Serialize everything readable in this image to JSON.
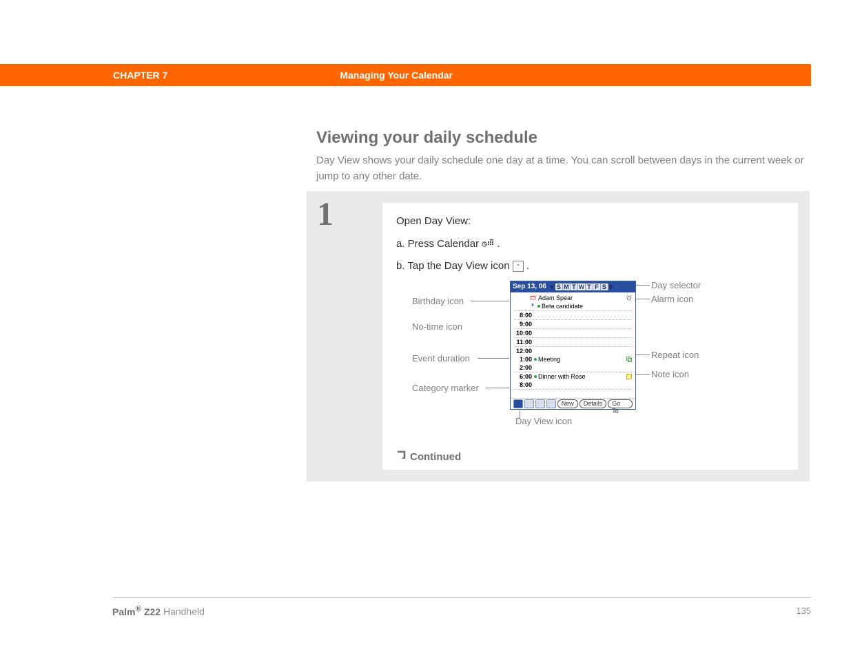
{
  "header": {
    "chapter": "CHAPTER 7",
    "title": "Managing Your Calendar"
  },
  "section": {
    "heading": "Viewing your daily schedule",
    "body": "Day View shows your daily schedule one day at a time. You can scroll between days in the current week or jump to any other date."
  },
  "step": {
    "number": "1",
    "open": "Open Day View:",
    "a_prefix": "a.  Press Calendar ",
    "a_suffix": ".",
    "b_prefix": "b.  Tap the Day View icon ",
    "b_suffix": ".",
    "continued": "Continued"
  },
  "annotations": {
    "birthday": "Birthday icon",
    "notime": "No-time icon",
    "duration": "Event duration",
    "category": "Category marker",
    "dayview": "Day View icon",
    "day_selector": "Day selector",
    "alarm": "Alarm icon",
    "repeat": "Repeat icon",
    "note": "Note icon"
  },
  "pda": {
    "date": "Sep 13, 06",
    "days": [
      "S",
      "M",
      "T",
      "W",
      "T",
      "F",
      "S"
    ],
    "selected_day_index": 3,
    "events": {
      "adam": "Adam Spear",
      "beta": "Beta candidate",
      "meeting": "Meeting",
      "dinner": "Dinner with Rose"
    },
    "times": {
      "t0800": "8:00",
      "t0900": "9:00",
      "t1000": "10:00",
      "t1100": "11:00",
      "t1200": "12:00",
      "t0100": "1:00",
      "t0200": "2:00",
      "t0600": "6:00",
      "t0800b": "8:00"
    },
    "buttons": {
      "new": "New",
      "details": "Details",
      "goto": "Go To"
    }
  },
  "footer": {
    "brand": "Palm",
    "reg": "®",
    "model": " Z22",
    "suffix": " Handheld",
    "page": "135"
  }
}
